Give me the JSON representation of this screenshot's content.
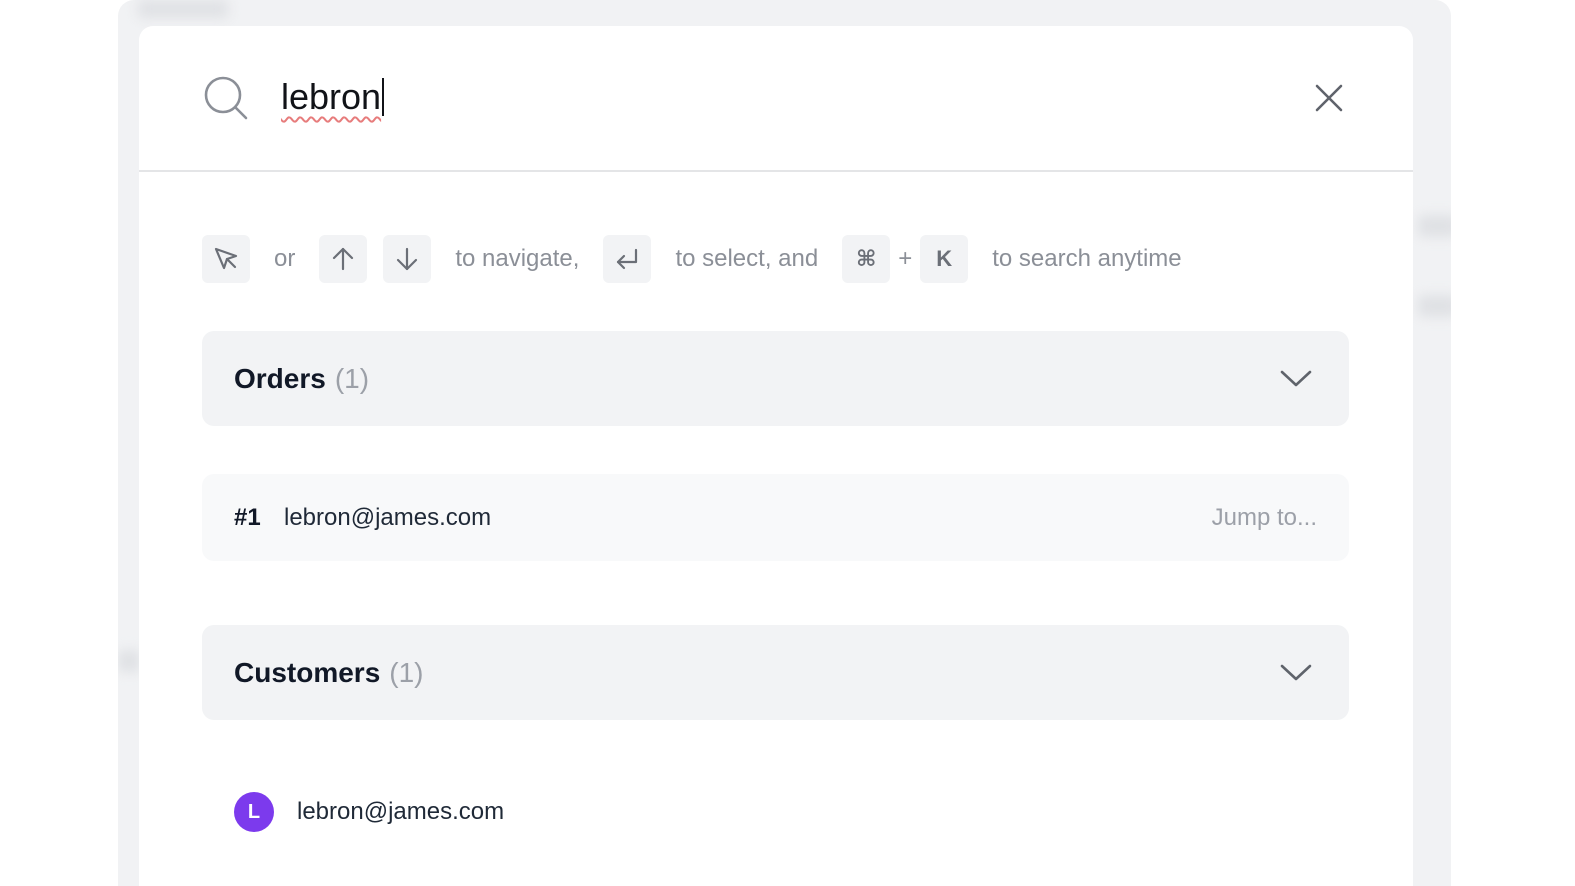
{
  "search": {
    "query": "lebron"
  },
  "hints": {
    "or": "or",
    "navigate": "to navigate,",
    "select": "to select, and",
    "plus": "+",
    "cmd_key": "⌘",
    "k_key": "K",
    "search_anytime": "to search anytime"
  },
  "sections": {
    "orders": {
      "title": "Orders",
      "count": "(1)",
      "items": [
        {
          "number": "#1",
          "email": "lebron@james.com",
          "action": "Jump to..."
        }
      ]
    },
    "customers": {
      "title": "Customers",
      "count": "(1)",
      "items": [
        {
          "initial": "L",
          "email": "lebron@james.com",
          "avatar_color": "#7c3aed"
        }
      ]
    }
  }
}
